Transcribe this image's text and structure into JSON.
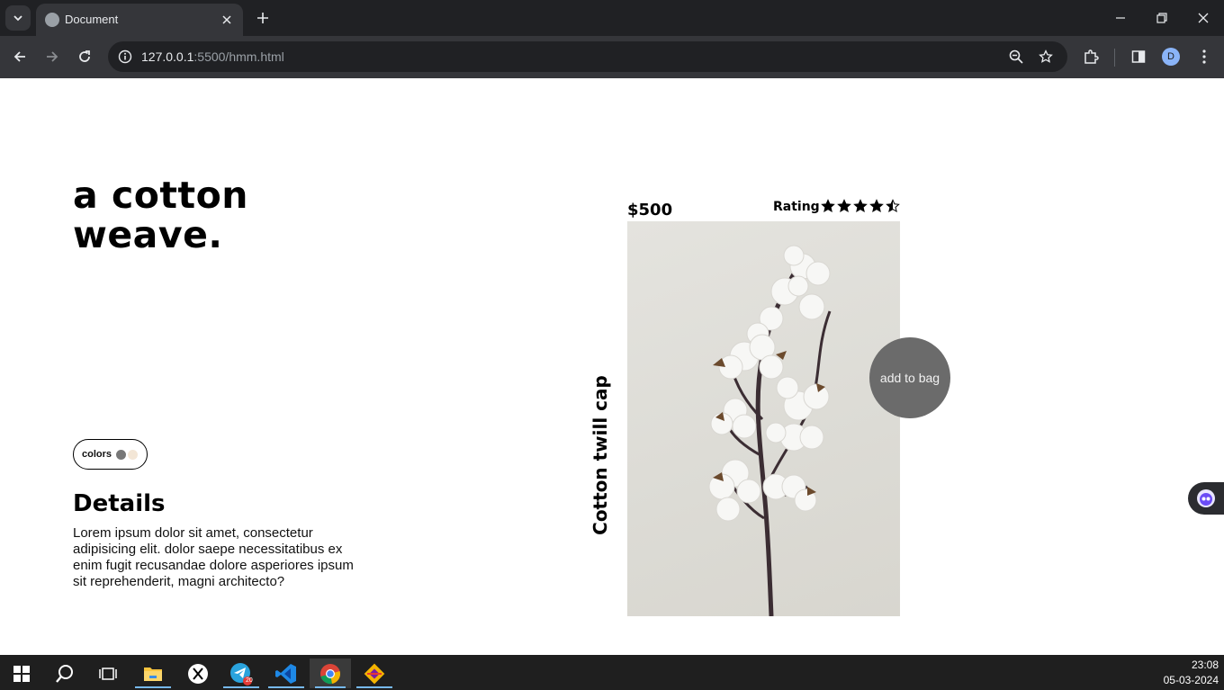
{
  "browser": {
    "tab_title": "Document",
    "url_host": "127.0.0.1",
    "url_path": ":5500/hmm.html",
    "profile_initial": "D"
  },
  "page": {
    "headline_line1": "a cotton",
    "headline_line2": "weave.",
    "colors_label": "colors",
    "swatches": [
      "#777777",
      "#f3e6d6"
    ],
    "details_title": "Details",
    "details_text": "Lorem ipsum dolor sit amet, consectetur adipisicing elit. dolor saepe necessitatibus ex enim fugit recusandae dolore asperiores ipsum sit reprehenderit, magni architecto?",
    "price": "$500",
    "rating_label": "Rating",
    "rating_value": 4.5,
    "product_name": "Cotton twill cap",
    "add_to_bag": "add to bag"
  },
  "taskbar": {
    "time": "23:08",
    "date": "05-03-2024",
    "telegram_badge": "20"
  }
}
